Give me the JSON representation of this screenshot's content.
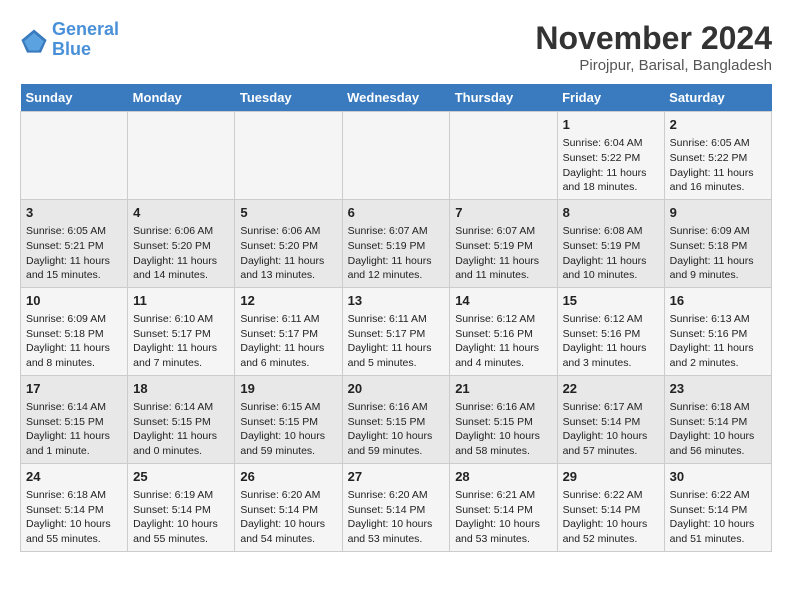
{
  "header": {
    "logo_line1": "General",
    "logo_line2": "Blue",
    "month_title": "November 2024",
    "location": "Pirojpur, Barisal, Bangladesh"
  },
  "days_of_week": [
    "Sunday",
    "Monday",
    "Tuesday",
    "Wednesday",
    "Thursday",
    "Friday",
    "Saturday"
  ],
  "weeks": [
    {
      "cells": [
        {
          "day": "",
          "content": ""
        },
        {
          "day": "",
          "content": ""
        },
        {
          "day": "",
          "content": ""
        },
        {
          "day": "",
          "content": ""
        },
        {
          "day": "",
          "content": ""
        },
        {
          "day": "1",
          "content": "Sunrise: 6:04 AM\nSunset: 5:22 PM\nDaylight: 11 hours and 18 minutes."
        },
        {
          "day": "2",
          "content": "Sunrise: 6:05 AM\nSunset: 5:22 PM\nDaylight: 11 hours and 16 minutes."
        }
      ]
    },
    {
      "cells": [
        {
          "day": "3",
          "content": "Sunrise: 6:05 AM\nSunset: 5:21 PM\nDaylight: 11 hours and 15 minutes."
        },
        {
          "day": "4",
          "content": "Sunrise: 6:06 AM\nSunset: 5:20 PM\nDaylight: 11 hours and 14 minutes."
        },
        {
          "day": "5",
          "content": "Sunrise: 6:06 AM\nSunset: 5:20 PM\nDaylight: 11 hours and 13 minutes."
        },
        {
          "day": "6",
          "content": "Sunrise: 6:07 AM\nSunset: 5:19 PM\nDaylight: 11 hours and 12 minutes."
        },
        {
          "day": "7",
          "content": "Sunrise: 6:07 AM\nSunset: 5:19 PM\nDaylight: 11 hours and 11 minutes."
        },
        {
          "day": "8",
          "content": "Sunrise: 6:08 AM\nSunset: 5:19 PM\nDaylight: 11 hours and 10 minutes."
        },
        {
          "day": "9",
          "content": "Sunrise: 6:09 AM\nSunset: 5:18 PM\nDaylight: 11 hours and 9 minutes."
        }
      ]
    },
    {
      "cells": [
        {
          "day": "10",
          "content": "Sunrise: 6:09 AM\nSunset: 5:18 PM\nDaylight: 11 hours and 8 minutes."
        },
        {
          "day": "11",
          "content": "Sunrise: 6:10 AM\nSunset: 5:17 PM\nDaylight: 11 hours and 7 minutes."
        },
        {
          "day": "12",
          "content": "Sunrise: 6:11 AM\nSunset: 5:17 PM\nDaylight: 11 hours and 6 minutes."
        },
        {
          "day": "13",
          "content": "Sunrise: 6:11 AM\nSunset: 5:17 PM\nDaylight: 11 hours and 5 minutes."
        },
        {
          "day": "14",
          "content": "Sunrise: 6:12 AM\nSunset: 5:16 PM\nDaylight: 11 hours and 4 minutes."
        },
        {
          "day": "15",
          "content": "Sunrise: 6:12 AM\nSunset: 5:16 PM\nDaylight: 11 hours and 3 minutes."
        },
        {
          "day": "16",
          "content": "Sunrise: 6:13 AM\nSunset: 5:16 PM\nDaylight: 11 hours and 2 minutes."
        }
      ]
    },
    {
      "cells": [
        {
          "day": "17",
          "content": "Sunrise: 6:14 AM\nSunset: 5:15 PM\nDaylight: 11 hours and 1 minute."
        },
        {
          "day": "18",
          "content": "Sunrise: 6:14 AM\nSunset: 5:15 PM\nDaylight: 11 hours and 0 minutes."
        },
        {
          "day": "19",
          "content": "Sunrise: 6:15 AM\nSunset: 5:15 PM\nDaylight: 10 hours and 59 minutes."
        },
        {
          "day": "20",
          "content": "Sunrise: 6:16 AM\nSunset: 5:15 PM\nDaylight: 10 hours and 59 minutes."
        },
        {
          "day": "21",
          "content": "Sunrise: 6:16 AM\nSunset: 5:15 PM\nDaylight: 10 hours and 58 minutes."
        },
        {
          "day": "22",
          "content": "Sunrise: 6:17 AM\nSunset: 5:14 PM\nDaylight: 10 hours and 57 minutes."
        },
        {
          "day": "23",
          "content": "Sunrise: 6:18 AM\nSunset: 5:14 PM\nDaylight: 10 hours and 56 minutes."
        }
      ]
    },
    {
      "cells": [
        {
          "day": "24",
          "content": "Sunrise: 6:18 AM\nSunset: 5:14 PM\nDaylight: 10 hours and 55 minutes."
        },
        {
          "day": "25",
          "content": "Sunrise: 6:19 AM\nSunset: 5:14 PM\nDaylight: 10 hours and 55 minutes."
        },
        {
          "day": "26",
          "content": "Sunrise: 6:20 AM\nSunset: 5:14 PM\nDaylight: 10 hours and 54 minutes."
        },
        {
          "day": "27",
          "content": "Sunrise: 6:20 AM\nSunset: 5:14 PM\nDaylight: 10 hours and 53 minutes."
        },
        {
          "day": "28",
          "content": "Sunrise: 6:21 AM\nSunset: 5:14 PM\nDaylight: 10 hours and 53 minutes."
        },
        {
          "day": "29",
          "content": "Sunrise: 6:22 AM\nSunset: 5:14 PM\nDaylight: 10 hours and 52 minutes."
        },
        {
          "day": "30",
          "content": "Sunrise: 6:22 AM\nSunset: 5:14 PM\nDaylight: 10 hours and 51 minutes."
        }
      ]
    }
  ]
}
